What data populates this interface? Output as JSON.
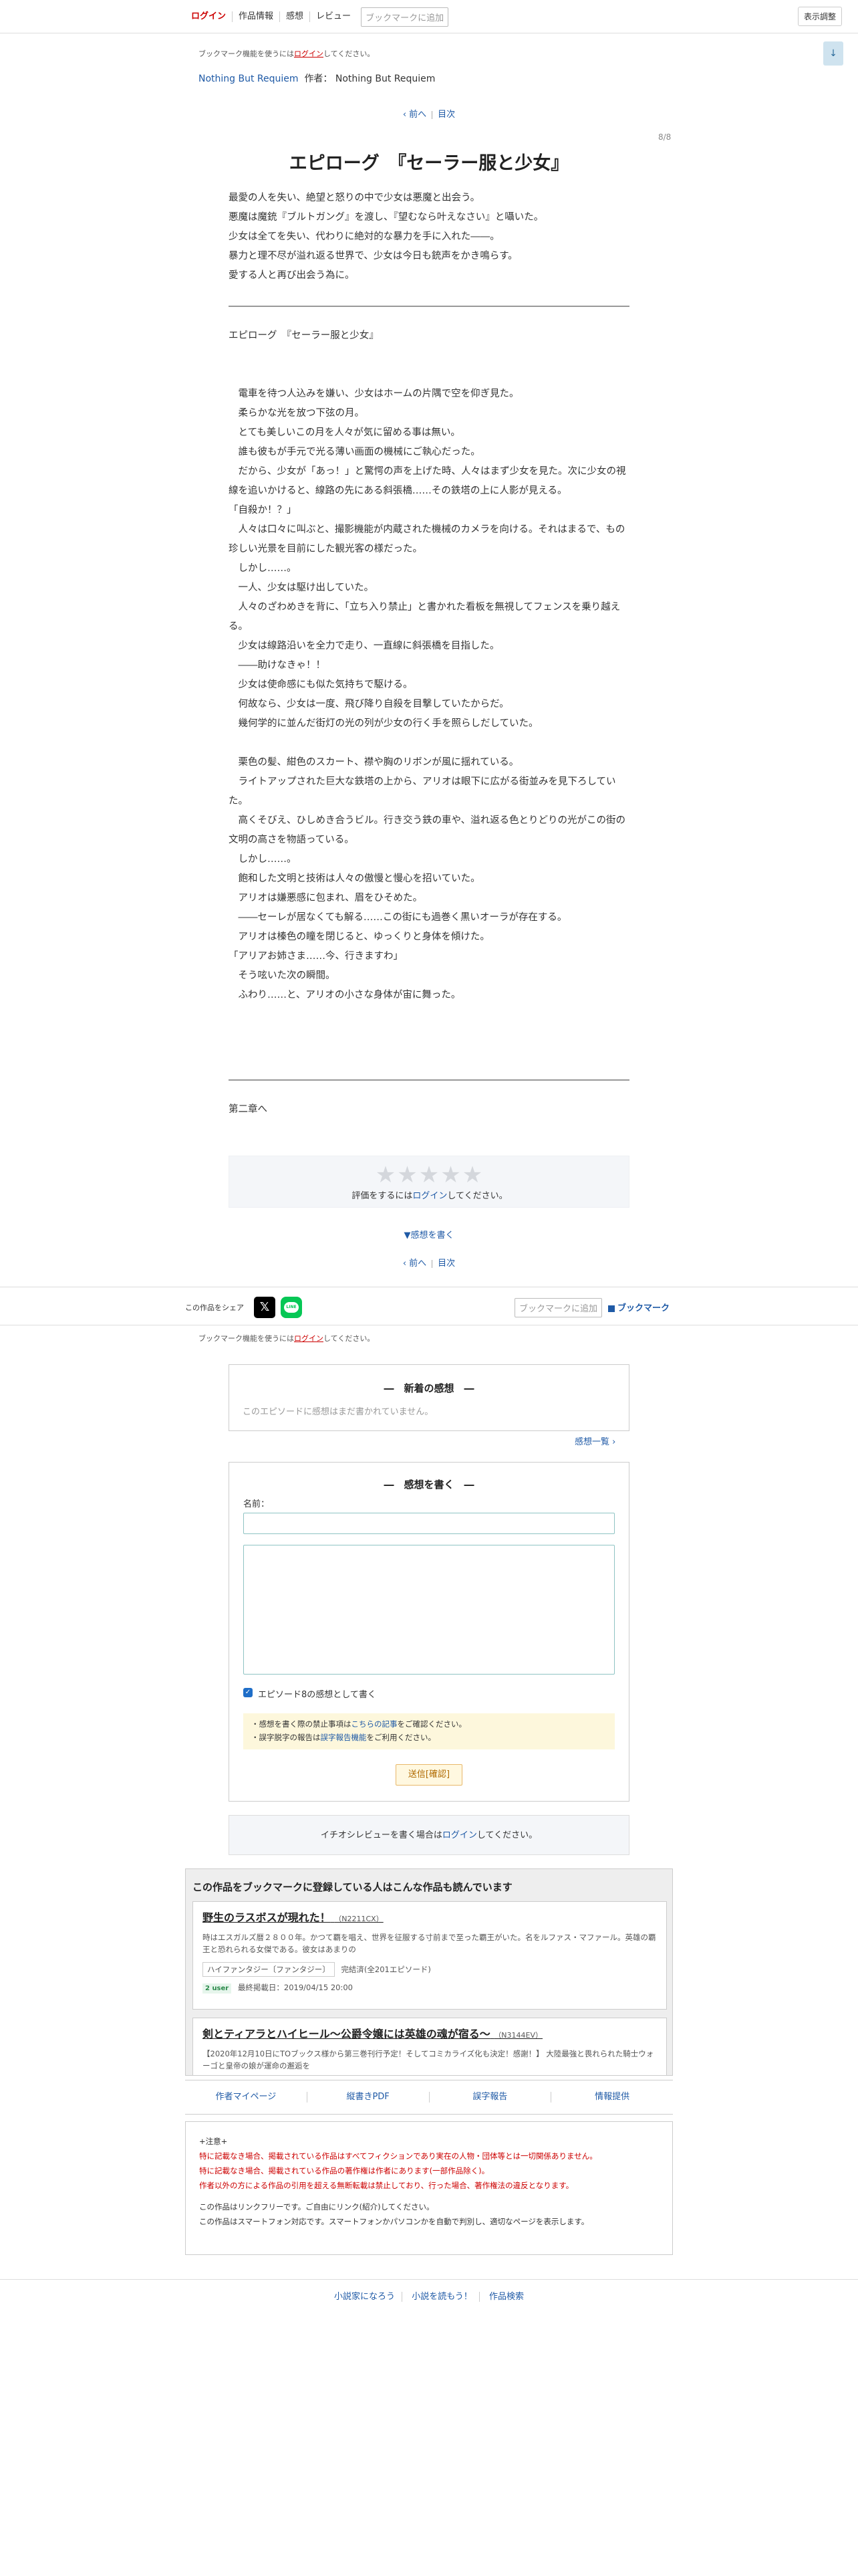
{
  "header": {
    "login": "ログイン",
    "nav": [
      "作品情報",
      "感想",
      "レビュー"
    ],
    "bookmark_add": "ブックマークに追加",
    "display_settings": "表示調整"
  },
  "login_note": {
    "before": "ブックマーク機能を使うには",
    "link": "ログイン",
    "after": "してください。"
  },
  "page_down_icon": "arrow-down-icon",
  "series": {
    "title": "Nothing But Requiem",
    "author_label": "作者：",
    "author": "Nothing But Requiem"
  },
  "pager": {
    "prev": "‹ 前へ",
    "toc": "目次"
  },
  "page_number": "8/8",
  "chapter_title": "エピローグ　『セーラー服と少女』",
  "preface": [
    "最愛の人を失い、絶望と怒りの中で少女は悪魔と出会う。",
    "悪魔は魔銃『ブルトガング』を渡し、『望むなら叶えなさい』と囁いた。",
    "少女は全てを失い、代わりに絶対的な暴力を手に入れた――。",
    "暴力と理不尽が溢れ返る世界で、少女は今日も銃声をかき鳴らす。",
    "愛する人と再び出会う為に。"
  ],
  "subtitle": "エピローグ　『セーラー服と少女』",
  "body_lines": [
    "　電車を待つ人込みを嫌い、少女はホームの片隅で空を仰ぎ見た。",
    "　柔らかな光を放つ下弦の月。",
    "　とても美しいこの月を人々が気に留める事は無い。",
    "　誰も彼もが手元で光る薄い画面の機械にご執心だった。",
    "　だから、少女が「あっ！」と驚愕の声を上げた時、人々はまず少女を見た。次に少女の視線を追いかけると、線路の先にある斜張橋……その鉄塔の上に人影が見える。",
    "「自殺か！？」",
    "　人々は口々に叫ぶと、撮影機能が内蔵された機械のカメラを向ける。それはまるで、もの珍しい光景を目前にした観光客の様だった。",
    "　しかし……。",
    "　一人、少女は駆け出していた。",
    "　人々のざわめきを背に、「立ち入り禁止」と書かれた看板を無視してフェンスを乗り越える。",
    "　少女は線路沿いを全力で走り、一直線に斜張橋を目指した。",
    "　――助けなきゃ！！",
    "　少女は使命感にも似た気持ちで駆ける。",
    "　何故なら、少女は一度、飛び降り自殺を目撃していたからだ。",
    "　幾何学的に並んだ街灯の光の列が少女の行く手を照らしだしていた。",
    "",
    "　栗色の髪、紺色のスカート、襟や胸のリボンが風に揺れている。",
    "　ライトアップされた巨大な鉄塔の上から、アリオは眼下に広がる街並みを見下ろしていた。",
    "　高くそびえ、ひしめき合うビル。行き交う鉄の車や、溢れ返る色とりどりの光がこの街の文明の高さを物語っている。",
    "　しかし……。",
    "　飽和した文明と技術は人々の傲慢と慢心を招いていた。",
    "　アリオは嫌悪感に包まれ、眉をひそめた。",
    "　――セーレが居なくても解る……この街にも過巻く黒いオーラが存在する。",
    "　アリオは榛色の瞳を閉じると、ゆっくりと身体を傾けた。",
    "「アリアお姉さま……今、行きますわ」",
    "　そう呟いた次の瞬間。",
    "　ふわり……と、アリオの小さな身体が宙に舞った。"
  ],
  "next_chapter": "第二章へ",
  "rating": {
    "stars": "★★★★★",
    "before": "評価をするには",
    "link": "ログイン",
    "after": "してください。"
  },
  "write_impression_link": "▼感想を書く",
  "share": {
    "label": "この作品をシェア",
    "x_icon": "x-logo-icon",
    "line_icon": "line-logo-icon",
    "line_text": "LINE",
    "bookmark_add": "ブックマークに追加",
    "bookmark": "ブックマーク"
  },
  "latest": {
    "title": "―　新着の感想　―",
    "empty": "このエピソードに感想はまだ書かれていません。",
    "more": "感想一覧 ›"
  },
  "write": {
    "title": "―　感想を書く　―",
    "name_label": "名前：",
    "checkbox_label": "エピソード8の感想として書く",
    "notice1_before": "・感想を書く際の禁止事項は",
    "notice1_link": "こちらの記事",
    "notice1_after": "をご確認ください。",
    "notice2_before": "・誤字脱字の報告は",
    "notice2_link": "誤字報告機能",
    "notice2_after": "をご利用ください。",
    "submit": "送信[確認]"
  },
  "review": {
    "before": "イチオシレビューを書く場合は",
    "link": "ログイン",
    "after": "してください。"
  },
  "recommend": {
    "title": "この作品をブックマークに登録している人はこんな作品も読んでいます",
    "items": [
      {
        "title": "野生のラスボスが現れた！",
        "code": "（N2211CX）",
        "desc": "時はエスガルズ暦２８００年。かつて覇を唱え、世界を征服する寸前まで至った覇王がいた。名をルファス・マファール。英雄の覇王と恐れられる女傑である。彼女はあまりの",
        "genre": "ハイファンタジー〔ファンタジー〕",
        "status": "完結済(全201エピソード)",
        "badge": "2 user",
        "updated": "最終掲載日：2019/04/15 20:00"
      },
      {
        "title": "剣とティアラとハイヒール〜公爵令嬢には英雄の魂が宿る〜",
        "code": "（N3144EV）",
        "desc": "【2020年12月10日にTOブックス様から第三巻刊行予定！そしてコミカライズ化も決定！感謝！】 大陸最強と畏れられた騎士ウォーゴと皇帝の娘が運命の邂逅を",
        "genre": "",
        "status": "",
        "badge": "",
        "updated": ""
      }
    ]
  },
  "footer_nav": [
    "作者マイページ",
    "縦書きPDF",
    "誤字報告",
    "情報提供"
  ],
  "legal": {
    "heading": "+注意+",
    "red1": "特に記載なき場合、掲載されている作品はすべてフィクションであり実在の人物・団体等とは一切関係ありません。",
    "red2": "特に記載なき場合、掲載されている作品の著作権は作者にあります(一部作品除く)。",
    "red3": "作者以外の方による作品の引用を超える無断転載は禁止しており、行った場合、著作権法の違反となります。",
    "line1": "この作品はリンクフリーです。ご自由にリンク(紹介)してください。",
    "line2": "この作品はスマートフォン対応です。スマートフォンかパソコンかを自動で判別し、適切なページを表示します。"
  },
  "bottom_links": [
    "小説家になろう",
    "小説を読もう！",
    "作品検索"
  ]
}
